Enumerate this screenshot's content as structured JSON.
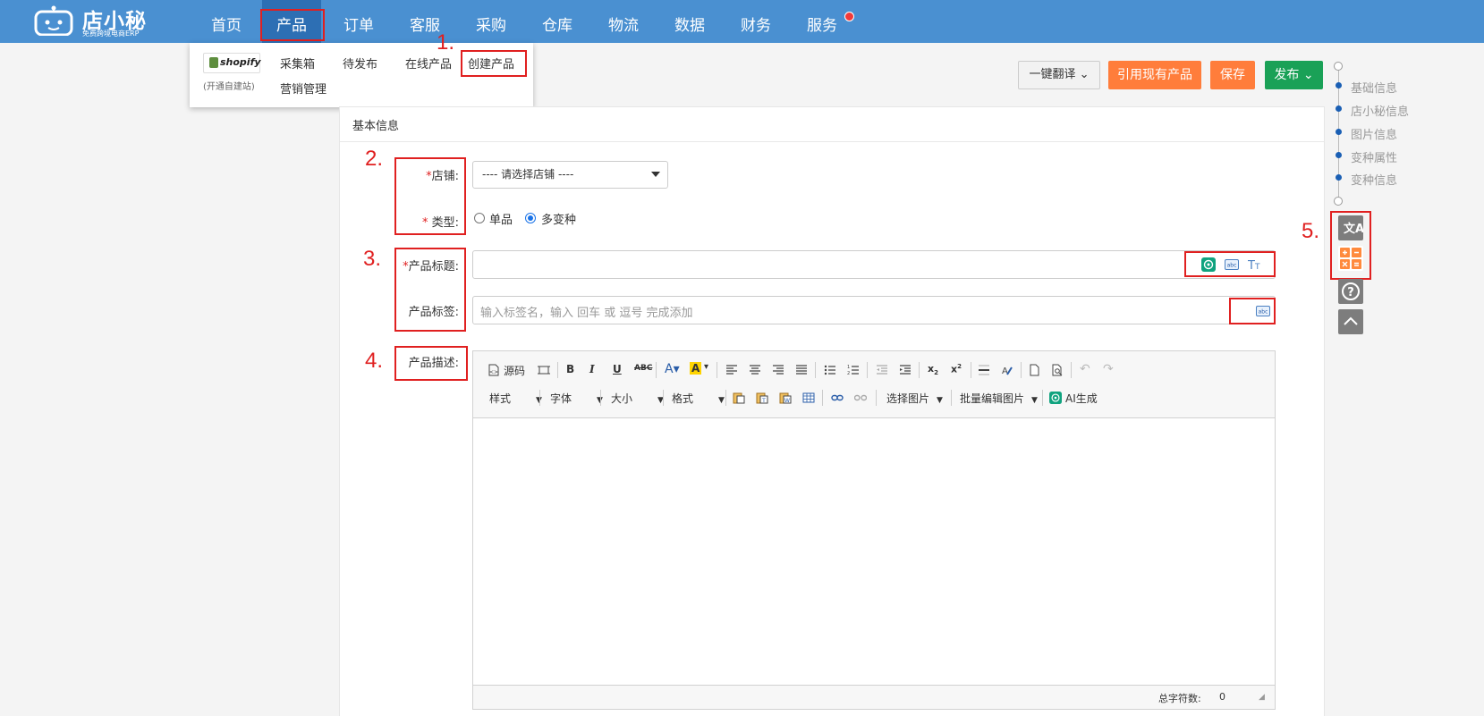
{
  "brand": {
    "name": "店小秘",
    "tagline": "免费跨境电商ERP"
  },
  "nav": [
    "首页",
    "产品",
    "订单",
    "客服",
    "采购",
    "仓库",
    "物流",
    "数据",
    "财务",
    "服务"
  ],
  "product_menu": {
    "shopify_label": "shopify",
    "shopify_note": "(开通自建站)",
    "items": [
      "采集箱",
      "待发布",
      "在线产品",
      "创建产品",
      "营销管理"
    ]
  },
  "actions": {
    "translate": "一键翻译",
    "reference": "引用现有产品",
    "save": "保存",
    "publish": "发布"
  },
  "panel_title": "基本信息",
  "form": {
    "store_label": "店铺:",
    "store_placeholder": "---- 请选择店铺 ----",
    "type_label": "类型:",
    "type_options": [
      "单品",
      "多变种"
    ],
    "type_selected": "多变种",
    "title_label": "产品标题:",
    "tags_label": "产品标签:",
    "tags_placeholder": "输入标签名，输入 回车 或 逗号 完成添加",
    "desc_label": "产品描述:"
  },
  "editor": {
    "source": "源码",
    "style": "样式",
    "font": "字体",
    "size": "大小",
    "format": "格式",
    "choose_image": "选择图片",
    "batch_edit": "批量编辑图片",
    "ai": "AI生成",
    "char_count_label": "总字符数:",
    "char_count": "0"
  },
  "rail": [
    "基础信息",
    "店小秘信息",
    "图片信息",
    "变种属性",
    "变种信息"
  ],
  "annotations": [
    "1.",
    "2.",
    "3.",
    "4.",
    "5."
  ],
  "colors": {
    "topbar": "#4a90d1",
    "orange": "#ff7d3b",
    "green": "#1aa157",
    "annotation": "#e02020"
  }
}
